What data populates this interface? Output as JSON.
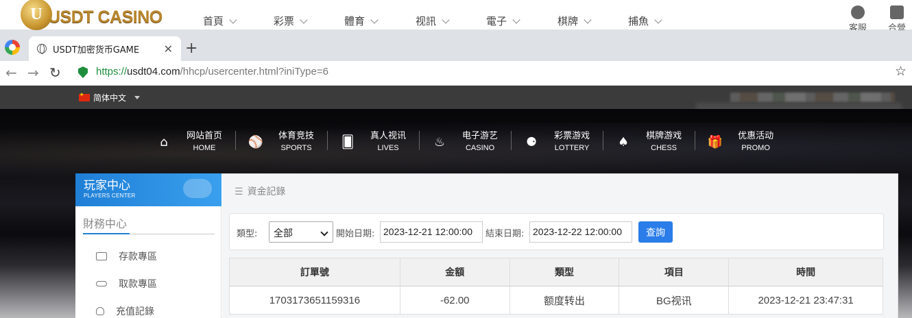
{
  "site": {
    "logo_letter": "U",
    "logo_text": "USDT CASINO",
    "nav": [
      "首頁",
      "彩票",
      "體育",
      "视訊",
      "電子",
      "棋牌",
      "捕魚"
    ],
    "right": [
      "客服",
      "合營"
    ]
  },
  "browser": {
    "tab_title": "USDT加密货币GAME",
    "url_scheme": "https://",
    "url_host": "usdt04.com",
    "url_path": "/hhcp/usercenter.html?iniType=6"
  },
  "lang": {
    "label": "简体中文"
  },
  "mainnav": [
    {
      "zh": "网站首页",
      "en": "HOME",
      "icon": "home-icon",
      "glyph": "⌂"
    },
    {
      "zh": "体育竞技",
      "en": "SPORTS",
      "icon": "ball-icon",
      "glyph": "⚾"
    },
    {
      "zh": "真人视讯",
      "en": "LIVES",
      "icon": "cards-icon",
      "glyph": "🂠"
    },
    {
      "zh": "电子游艺",
      "en": "CASINO",
      "icon": "slot-icon",
      "glyph": "♨"
    },
    {
      "zh": "彩票游戏",
      "en": "LOTTERY",
      "icon": "lottery-balls-icon",
      "glyph": "⚈"
    },
    {
      "zh": "棋牌游戏",
      "en": "CHESS",
      "icon": "spade-icon",
      "glyph": "♠"
    },
    {
      "zh": "优惠活动",
      "en": "PROMO",
      "icon": "gift-icon",
      "glyph": "🎁"
    }
  ],
  "sidebar": {
    "title_zh": "玩家中心",
    "title_en": "PLAYERS CENTER",
    "section": "財務中心",
    "items": [
      "存款專區",
      "取款專區",
      "充值記錄"
    ]
  },
  "content": {
    "breadcrumb_icon": "☰",
    "breadcrumb": "資金記錄",
    "filter": {
      "type_label": "類型:",
      "type_value": "全部",
      "start_label": "開始日期:",
      "start_value": "2023-12-21 12:00:00",
      "end_label": "結束日期:",
      "end_value": "2023-12-22 12:00:00",
      "query": "查詢"
    },
    "table": {
      "headers": [
        "訂單號",
        "金額",
        "類型",
        "項目",
        "時間"
      ],
      "rows": [
        [
          "1703173651159316",
          "-62.00",
          "额度转出",
          "BG视讯",
          "2023-12-21 23:47:31"
        ]
      ]
    }
  }
}
